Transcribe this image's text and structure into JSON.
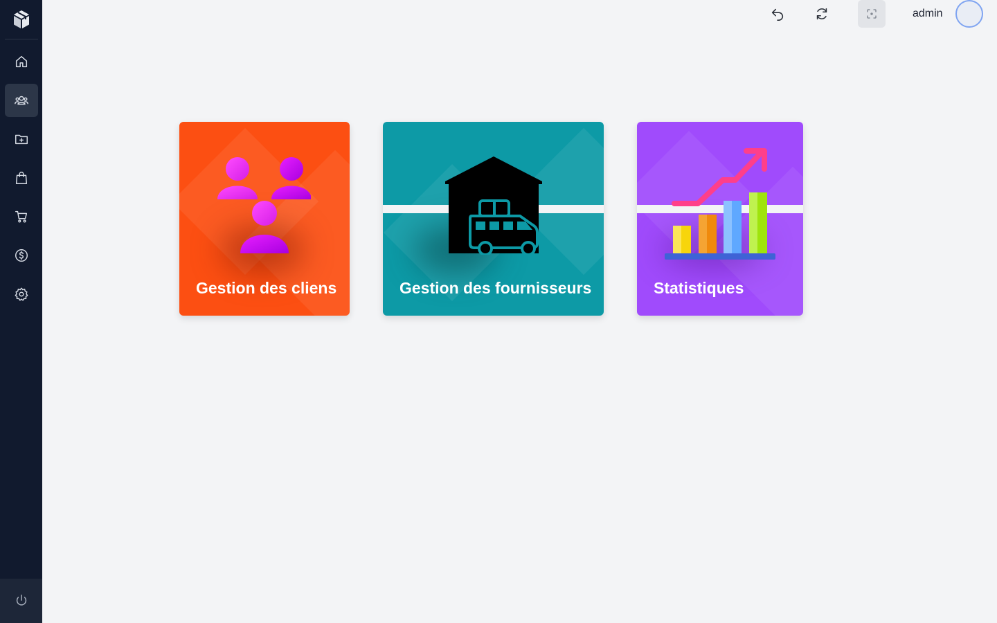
{
  "header": {
    "username": "admin"
  },
  "icons": {
    "logo": "cube-logo-icon",
    "undo": "undo-icon",
    "refresh": "refresh-icon",
    "focus": "focus-icon"
  },
  "sidebar": {
    "items": [
      {
        "icon": "home-icon"
      },
      {
        "icon": "users-icon",
        "active": true
      },
      {
        "icon": "folder-plus-icon"
      },
      {
        "icon": "shopping-bag-icon"
      },
      {
        "icon": "cart-icon"
      },
      {
        "icon": "dollar-icon"
      },
      {
        "icon": "settings-icon"
      }
    ],
    "logout_icon": "power-icon"
  },
  "cards": [
    {
      "title": "Gestion des cliens",
      "color": "#fc4f12",
      "icon": "clients-illustration"
    },
    {
      "title": "Gestion des fournisseurs",
      "color": "#0d9aa6",
      "icon": "warehouse-truck-illustration"
    },
    {
      "title": "Statistiques",
      "color": "#a04bfc",
      "icon": "bar-chart-illustration"
    }
  ]
}
